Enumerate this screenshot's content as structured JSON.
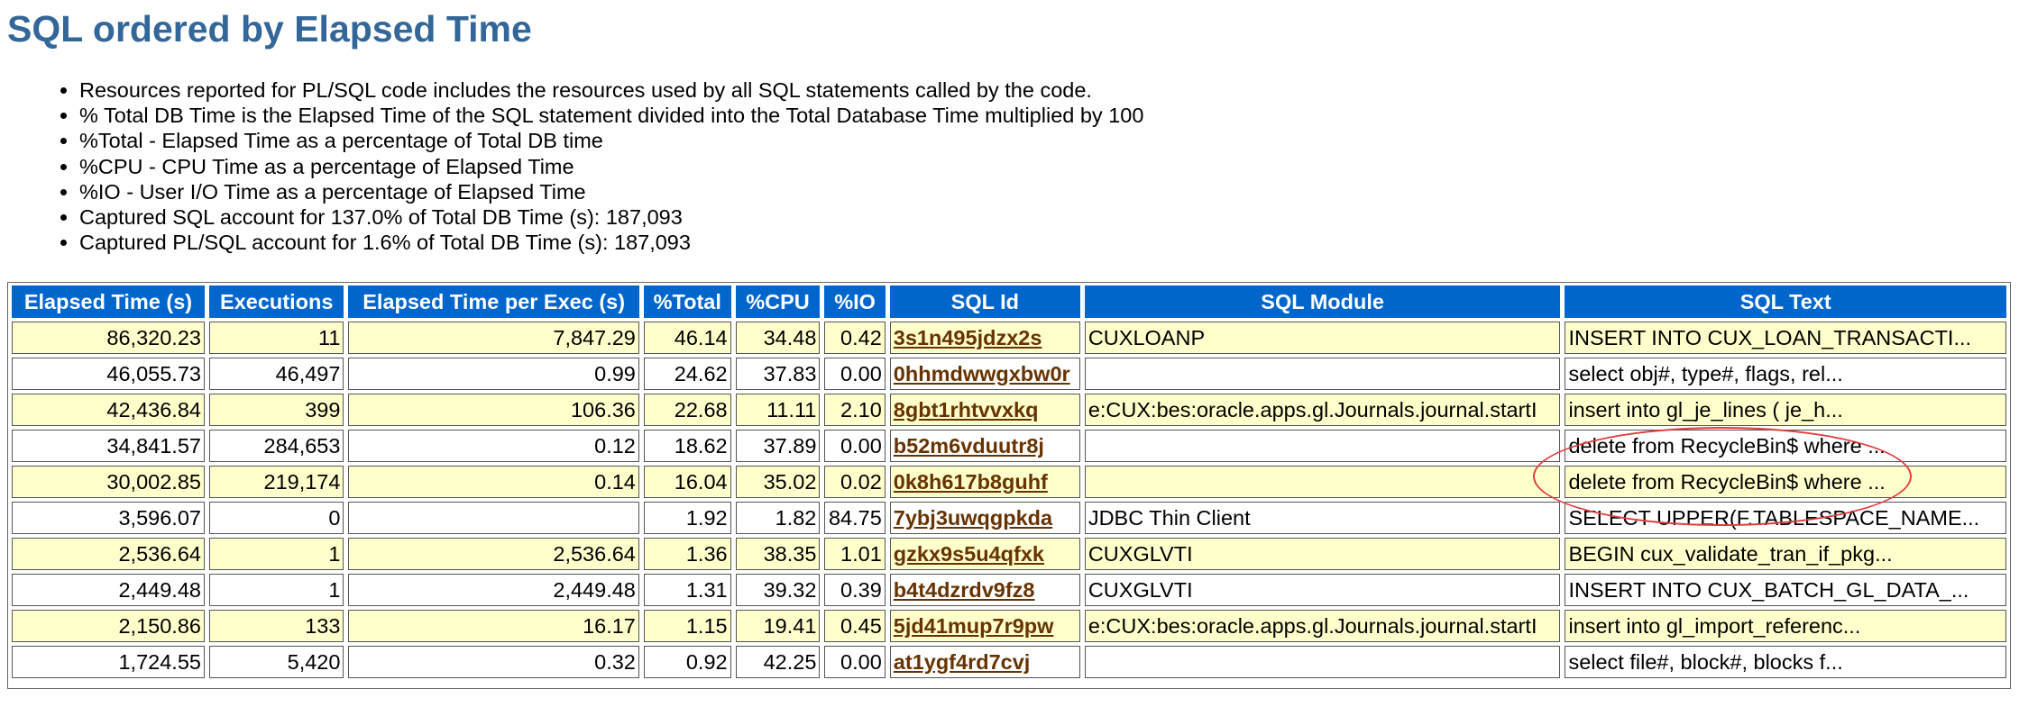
{
  "page": {
    "title": "SQL ordered by Elapsed Time"
  },
  "notes": [
    "Resources reported for PL/SQL code includes the resources used by all SQL statements called by the code.",
    "% Total DB Time is the Elapsed Time of the SQL statement divided into the Total Database Time multiplied by 100",
    "%Total - Elapsed Time as a percentage of Total DB time",
    "%CPU - CPU Time as a percentage of Elapsed Time",
    "%IO - User I/O Time as a percentage of Elapsed Time",
    "Captured SQL account for 137.0% of Total DB Time (s): 187,093",
    "Captured PL/SQL account for 1.6% of Total DB Time (s): 187,093"
  ],
  "table": {
    "headers": [
      "Elapsed Time (s)",
      "Executions",
      "Elapsed Time per Exec (s)",
      "%Total",
      "%CPU",
      "%IO",
      "SQL Id",
      "SQL Module",
      "SQL Text"
    ],
    "rows": [
      {
        "elapsed": "86,320.23",
        "executions": "11",
        "per_exec": "7,847.29",
        "total": "46.14",
        "cpu": "34.48",
        "io": "0.42",
        "sql_id": "3s1n495jdzx2s",
        "module": "CUXLOANP",
        "text": "INSERT INTO CUX_LOAN_TRANSACTI..."
      },
      {
        "elapsed": "46,055.73",
        "executions": "46,497",
        "per_exec": "0.99",
        "total": "24.62",
        "cpu": "37.83",
        "io": "0.00",
        "sql_id": "0hhmdwwgxbw0r",
        "module": "",
        "text": "select obj#, type#, flags, rel..."
      },
      {
        "elapsed": "42,436.84",
        "executions": "399",
        "per_exec": "106.36",
        "total": "22.68",
        "cpu": "11.11",
        "io": "2.10",
        "sql_id": "8gbt1rhtvvxkq",
        "module": "e:CUX:bes:oracle.apps.gl.Journals.journal.startI",
        "text": "insert into gl_je_lines ( je_h..."
      },
      {
        "elapsed": "34,841.57",
        "executions": "284,653",
        "per_exec": "0.12",
        "total": "18.62",
        "cpu": "37.89",
        "io": "0.00",
        "sql_id": "b52m6vduutr8j",
        "module": "",
        "text": "delete from RecycleBin$ where ..."
      },
      {
        "elapsed": "30,002.85",
        "executions": "219,174",
        "per_exec": "0.14",
        "total": "16.04",
        "cpu": "35.02",
        "io": "0.02",
        "sql_id": "0k8h617b8guhf",
        "module": "",
        "text": "delete from RecycleBin$ where ..."
      },
      {
        "elapsed": "3,596.07",
        "executions": "0",
        "per_exec": "",
        "total": "1.92",
        "cpu": "1.82",
        "io": "84.75",
        "sql_id": "7ybj3uwqgpkda",
        "module": "JDBC Thin Client",
        "text": "SELECT UPPER(F.TABLESPACE_NAME..."
      },
      {
        "elapsed": "2,536.64",
        "executions": "1",
        "per_exec": "2,536.64",
        "total": "1.36",
        "cpu": "38.35",
        "io": "1.01",
        "sql_id": "gzkx9s5u4qfxk",
        "module": "CUXGLVTI",
        "text": "BEGIN cux_validate_tran_if_pkg..."
      },
      {
        "elapsed": "2,449.48",
        "executions": "1",
        "per_exec": "2,449.48",
        "total": "1.31",
        "cpu": "39.32",
        "io": "0.39",
        "sql_id": "b4t4dzrdv9fz8",
        "module": "CUXGLVTI",
        "text": "INSERT INTO CUX_BATCH_GL_DATA_..."
      },
      {
        "elapsed": "2,150.86",
        "executions": "133",
        "per_exec": "16.17",
        "total": "1.15",
        "cpu": "19.41",
        "io": "0.45",
        "sql_id": "5jd41mup7r9pw",
        "module": "e:CUX:bes:oracle.apps.gl.Journals.journal.startI",
        "text": "insert into gl_import_referenc..."
      },
      {
        "elapsed": "1,724.55",
        "executions": "5,420",
        "per_exec": "0.32",
        "total": "0.92",
        "cpu": "42.25",
        "io": "0.00",
        "sql_id": "at1ygf4rd7cvj",
        "module": "",
        "text": "select file#, block#, blocks f..."
      }
    ]
  },
  "colors": {
    "title": "#336699",
    "header_bg": "#0066cc",
    "odd_row_bg": "#ffffcc",
    "link": "#663300",
    "annotation_ring": "#e03c3c"
  }
}
